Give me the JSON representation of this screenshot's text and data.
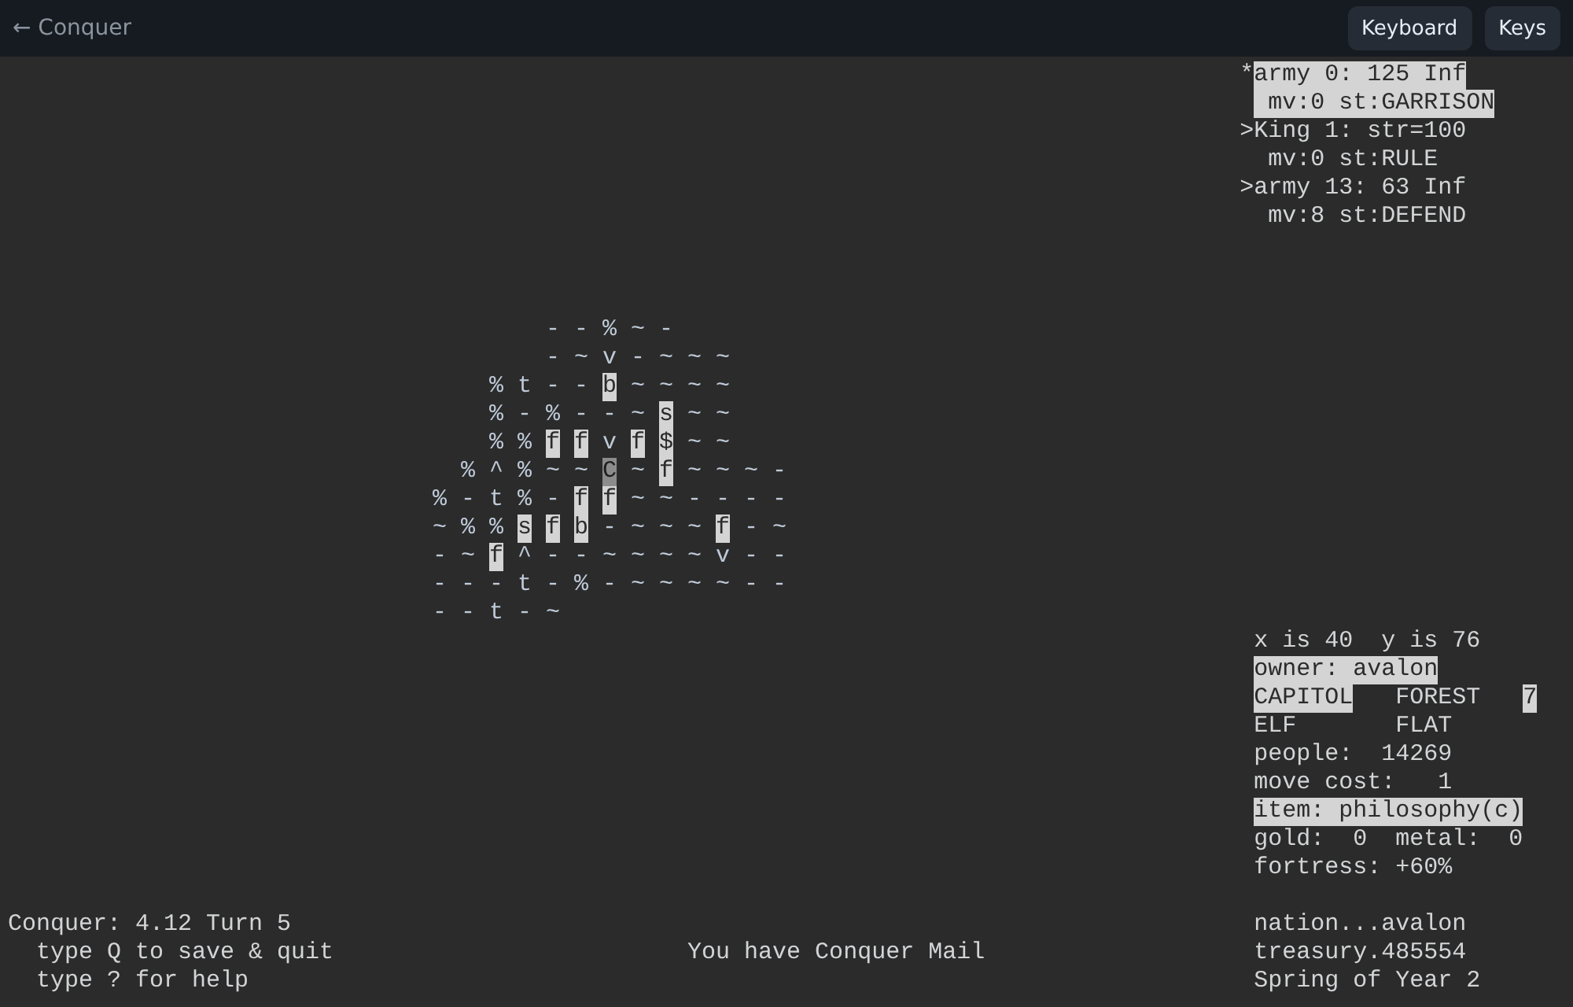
{
  "header": {
    "back_link": "← Conquer",
    "buttons": [
      "Keyboard",
      "Keys"
    ]
  },
  "units": [
    {
      "marker": "*",
      "title": "army 0: 125 Inf",
      "status": "mv:0 st:GARRISON",
      "selected": true
    },
    {
      "marker": ">",
      "title": "King 1: str=100",
      "status": "mv:0 st:RULE",
      "selected": false
    },
    {
      "marker": ">",
      "title": "army 13: 63 Inf",
      "status": "mv:8 st:DEFEND",
      "selected": false
    }
  ],
  "map": {
    "rows": [
      {
        "cells": [
          null,
          null,
          null,
          null,
          {
            "symbol": "-",
            "kind": "plain"
          },
          {
            "symbol": "-",
            "kind": "plain"
          },
          {
            "symbol": "%",
            "kind": "plain"
          },
          {
            "symbol": "~",
            "kind": "plain"
          },
          {
            "symbol": "-",
            "kind": "plain"
          }
        ]
      },
      {
        "cells": [
          null,
          null,
          null,
          null,
          {
            "symbol": "-",
            "kind": "plain"
          },
          {
            "symbol": "~",
            "kind": "plain"
          },
          {
            "symbol": "v",
            "kind": "plain"
          },
          {
            "symbol": "-",
            "kind": "plain"
          },
          {
            "symbol": "~",
            "kind": "plain"
          },
          {
            "symbol": "~",
            "kind": "plain"
          },
          {
            "symbol": "~",
            "kind": "plain"
          }
        ]
      },
      {
        "cells": [
          null,
          null,
          {
            "symbol": "%",
            "kind": "plain"
          },
          {
            "symbol": "t",
            "kind": "plain"
          },
          {
            "symbol": "-",
            "kind": "plain"
          },
          {
            "symbol": "-",
            "kind": "plain"
          },
          {
            "symbol": "b",
            "kind": "marked"
          },
          {
            "symbol": "~",
            "kind": "plain"
          },
          {
            "symbol": "~",
            "kind": "plain"
          },
          {
            "symbol": "~",
            "kind": "plain"
          },
          {
            "symbol": "~",
            "kind": "plain"
          }
        ]
      },
      {
        "cells": [
          null,
          null,
          {
            "symbol": "%",
            "kind": "plain"
          },
          {
            "symbol": "-",
            "kind": "plain"
          },
          {
            "symbol": "%",
            "kind": "plain"
          },
          {
            "symbol": "-",
            "kind": "plain"
          },
          {
            "symbol": "-",
            "kind": "plain"
          },
          {
            "symbol": "~",
            "kind": "plain"
          },
          {
            "symbol": "s",
            "kind": "marked"
          },
          {
            "symbol": "~",
            "kind": "plain"
          },
          {
            "symbol": "~",
            "kind": "plain"
          }
        ]
      },
      {
        "cells": [
          null,
          null,
          {
            "symbol": "%",
            "kind": "plain"
          },
          {
            "symbol": "%",
            "kind": "plain"
          },
          {
            "symbol": "f",
            "kind": "marked"
          },
          {
            "symbol": "f",
            "kind": "marked"
          },
          {
            "symbol": "v",
            "kind": "plain"
          },
          {
            "symbol": "f",
            "kind": "marked"
          },
          {
            "symbol": "$",
            "kind": "marked"
          },
          {
            "symbol": "~",
            "kind": "plain"
          },
          {
            "symbol": "~",
            "kind": "plain"
          }
        ]
      },
      {
        "cells": [
          null,
          {
            "symbol": "%",
            "kind": "plain"
          },
          {
            "symbol": "^",
            "kind": "plain"
          },
          {
            "symbol": "%",
            "kind": "plain"
          },
          {
            "symbol": "~",
            "kind": "plain"
          },
          {
            "symbol": "~",
            "kind": "plain"
          },
          {
            "symbol": "C",
            "kind": "cursor"
          },
          {
            "symbol": "~",
            "kind": "plain"
          },
          {
            "symbol": "f",
            "kind": "marked"
          },
          {
            "symbol": "~",
            "kind": "plain"
          },
          {
            "symbol": "~",
            "kind": "plain"
          },
          {
            "symbol": "~",
            "kind": "plain"
          },
          {
            "symbol": "-",
            "kind": "plain"
          }
        ]
      },
      {
        "cells": [
          {
            "symbol": "%",
            "kind": "plain"
          },
          {
            "symbol": "-",
            "kind": "plain"
          },
          {
            "symbol": "t",
            "kind": "plain"
          },
          {
            "symbol": "%",
            "kind": "plain"
          },
          {
            "symbol": "-",
            "kind": "plain"
          },
          {
            "symbol": "f",
            "kind": "marked"
          },
          {
            "symbol": "f",
            "kind": "marked"
          },
          {
            "symbol": "~",
            "kind": "plain"
          },
          {
            "symbol": "~",
            "kind": "plain"
          },
          {
            "symbol": "-",
            "kind": "plain"
          },
          {
            "symbol": "-",
            "kind": "plain"
          },
          {
            "symbol": "-",
            "kind": "plain"
          },
          {
            "symbol": "-",
            "kind": "plain"
          }
        ]
      },
      {
        "cells": [
          {
            "symbol": "~",
            "kind": "plain"
          },
          {
            "symbol": "%",
            "kind": "plain"
          },
          {
            "symbol": "%",
            "kind": "plain"
          },
          {
            "symbol": "s",
            "kind": "marked"
          },
          {
            "symbol": "f",
            "kind": "marked"
          },
          {
            "symbol": "b",
            "kind": "marked"
          },
          {
            "symbol": "-",
            "kind": "plain"
          },
          {
            "symbol": "~",
            "kind": "plain"
          },
          {
            "symbol": "~",
            "kind": "plain"
          },
          {
            "symbol": "~",
            "kind": "plain"
          },
          {
            "symbol": "f",
            "kind": "marked"
          },
          {
            "symbol": "-",
            "kind": "plain"
          },
          {
            "symbol": "~",
            "kind": "plain"
          }
        ]
      },
      {
        "cells": [
          {
            "symbol": "-",
            "kind": "plain"
          },
          {
            "symbol": "~",
            "kind": "plain"
          },
          {
            "symbol": "f",
            "kind": "marked"
          },
          {
            "symbol": "^",
            "kind": "plain"
          },
          {
            "symbol": "-",
            "kind": "plain"
          },
          {
            "symbol": "-",
            "kind": "plain"
          },
          {
            "symbol": "~",
            "kind": "plain"
          },
          {
            "symbol": "~",
            "kind": "plain"
          },
          {
            "symbol": "~",
            "kind": "plain"
          },
          {
            "symbol": "~",
            "kind": "plain"
          },
          {
            "symbol": "v",
            "kind": "plain"
          },
          {
            "symbol": "-",
            "kind": "plain"
          },
          {
            "symbol": "-",
            "kind": "plain"
          }
        ]
      },
      {
        "cells": [
          {
            "symbol": "-",
            "kind": "plain"
          },
          {
            "symbol": "-",
            "kind": "plain"
          },
          {
            "symbol": "-",
            "kind": "plain"
          },
          {
            "symbol": "t",
            "kind": "plain"
          },
          {
            "symbol": "-",
            "kind": "plain"
          },
          {
            "symbol": "%",
            "kind": "plain"
          },
          {
            "symbol": "-",
            "kind": "plain"
          },
          {
            "symbol": "~",
            "kind": "plain"
          },
          {
            "symbol": "~",
            "kind": "plain"
          },
          {
            "symbol": "~",
            "kind": "plain"
          },
          {
            "symbol": "~",
            "kind": "plain"
          },
          {
            "symbol": "-",
            "kind": "plain"
          },
          {
            "symbol": "-",
            "kind": "plain"
          }
        ]
      },
      {
        "cells": [
          {
            "symbol": "-",
            "kind": "plain"
          },
          {
            "symbol": "-",
            "kind": "plain"
          },
          {
            "symbol": "t",
            "kind": "plain"
          },
          {
            "symbol": "-",
            "kind": "plain"
          },
          {
            "symbol": "~",
            "kind": "plain"
          }
        ]
      }
    ]
  },
  "sector": {
    "coordinates": "x is 40  y is 76",
    "owner": {
      "text": "owner: avalon",
      "highlighted": true
    },
    "designation": {
      "text": "CAPITOL",
      "highlighted": true
    },
    "vegetation": "FOREST",
    "value": {
      "text": "7",
      "highlighted": true
    },
    "race": "ELF",
    "elevation": "FLAT",
    "people": "people:  14269",
    "move_cost": "move cost:   1",
    "item": {
      "text": "item: philosophy(c)",
      "highlighted": true
    },
    "gold": "gold:  0",
    "metal": "metal:  0",
    "fortress": "fortress: +60%"
  },
  "status": {
    "version": "Conquer: 4.12 Turn 5",
    "hints": [
      "type Q to save & quit",
      "type ? for help"
    ],
    "mail": "You have Conquer Mail"
  },
  "nation": {
    "name": "nation...avalon",
    "treasury": "treasury.485554",
    "season": "Spring of Year 2"
  }
}
